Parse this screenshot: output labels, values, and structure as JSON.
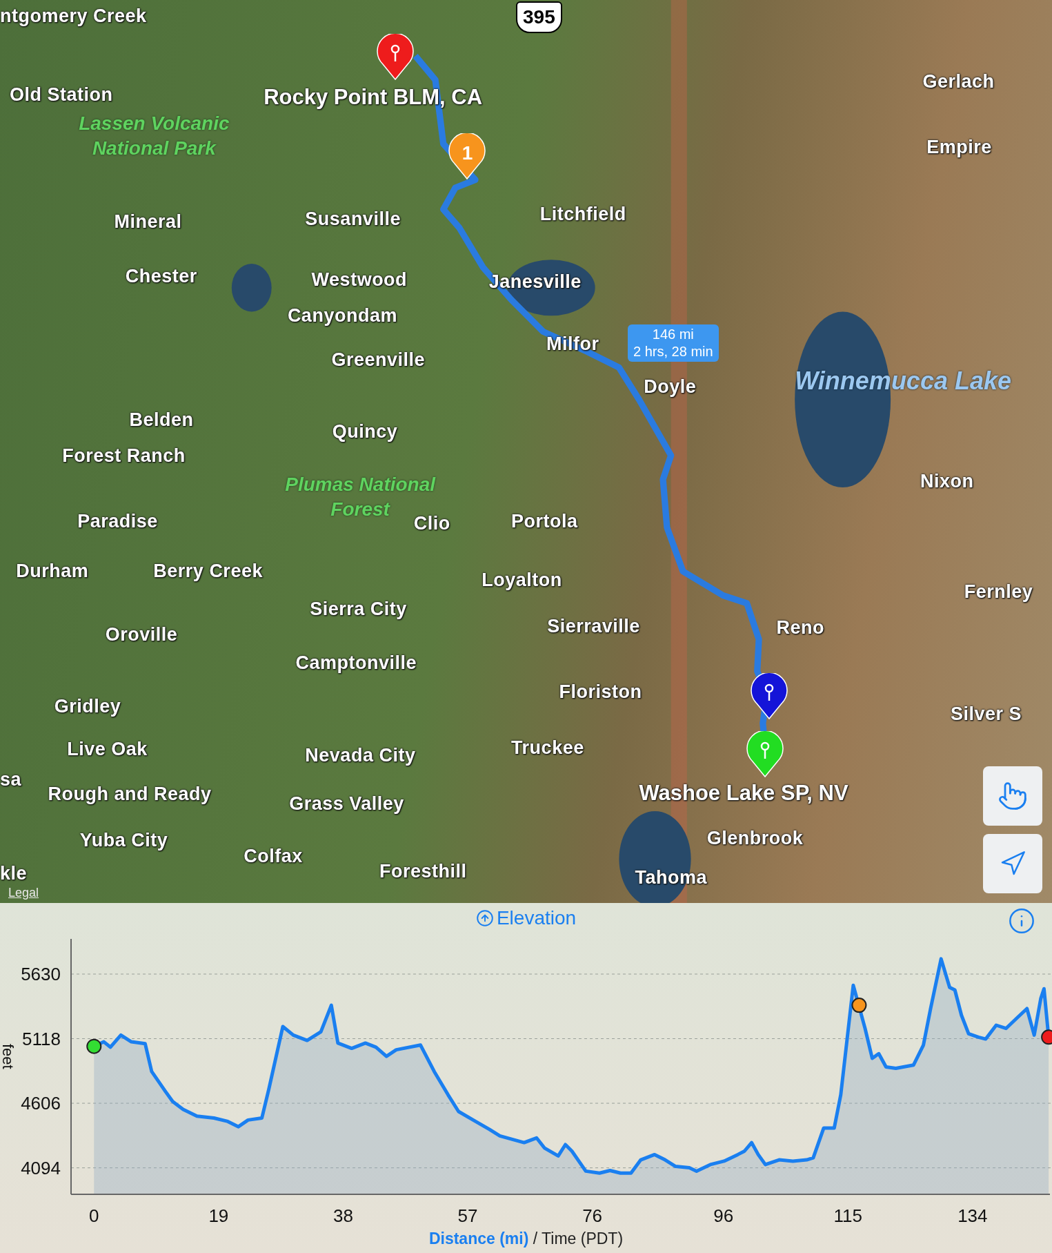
{
  "map": {
    "labels": [
      {
        "text": "ntgomery Creek",
        "kind": "place"
      },
      {
        "text": "Old Station",
        "kind": "place"
      },
      {
        "text": "Rocky Point BLM, CA",
        "kind": "poi"
      },
      {
        "text": "Gerlach",
        "kind": "place"
      },
      {
        "text": "Lassen Volcanic National Park",
        "kind": "park"
      },
      {
        "text": "Empire",
        "kind": "place"
      },
      {
        "text": "Mineral",
        "kind": "place"
      },
      {
        "text": "Susanville",
        "kind": "place"
      },
      {
        "text": "Litchfield",
        "kind": "place"
      },
      {
        "text": "Chester",
        "kind": "place"
      },
      {
        "text": "Westwood",
        "kind": "place"
      },
      {
        "text": "Janesville",
        "kind": "place"
      },
      {
        "text": "Canyondam",
        "kind": "place"
      },
      {
        "text": "Milfor",
        "kind": "place"
      },
      {
        "text": "Greenville",
        "kind": "place"
      },
      {
        "text": "Winnemucca Lake",
        "kind": "lake"
      },
      {
        "text": "Doyle",
        "kind": "place"
      },
      {
        "text": "Belden",
        "kind": "place"
      },
      {
        "text": "Quincy",
        "kind": "place"
      },
      {
        "text": "Forest Ranch",
        "kind": "place"
      },
      {
        "text": "Plumas National Forest",
        "kind": "park"
      },
      {
        "text": "Nixon",
        "kind": "place"
      },
      {
        "text": "Paradise",
        "kind": "place"
      },
      {
        "text": "Clio",
        "kind": "place"
      },
      {
        "text": "Portola",
        "kind": "place"
      },
      {
        "text": "Durham",
        "kind": "place"
      },
      {
        "text": "Berry Creek",
        "kind": "place"
      },
      {
        "text": "Loyalton",
        "kind": "place"
      },
      {
        "text": "Fernley",
        "kind": "place"
      },
      {
        "text": "Sierra City",
        "kind": "place"
      },
      {
        "text": "Sierraville",
        "kind": "place"
      },
      {
        "text": "Reno",
        "kind": "place"
      },
      {
        "text": "Oroville",
        "kind": "place"
      },
      {
        "text": "Camptonville",
        "kind": "place"
      },
      {
        "text": "Floriston",
        "kind": "place"
      },
      {
        "text": "Gridley",
        "kind": "place"
      },
      {
        "text": "Silver S",
        "kind": "place"
      },
      {
        "text": "Live Oak",
        "kind": "place"
      },
      {
        "text": "Truckee",
        "kind": "place"
      },
      {
        "text": "Nevada City",
        "kind": "place"
      },
      {
        "text": "sa",
        "kind": "place"
      },
      {
        "text": "Rough and Ready",
        "kind": "place"
      },
      {
        "text": "Washoe Lake SP, NV",
        "kind": "poi"
      },
      {
        "text": "Grass Valley",
        "kind": "place"
      },
      {
        "text": "Glenbrook",
        "kind": "place"
      },
      {
        "text": "Yuba City",
        "kind": "place"
      },
      {
        "text": "Colfax",
        "kind": "place"
      },
      {
        "text": "kle",
        "kind": "place"
      },
      {
        "text": "Foresthill",
        "kind": "place"
      },
      {
        "text": "Tahoma",
        "kind": "place"
      }
    ],
    "highway": "395",
    "pins": [
      {
        "color": "#ee1c1c"
      },
      {
        "color": "#f7941d",
        "label": "1"
      },
      {
        "color": "#1414d8"
      },
      {
        "color": "#22dd22"
      }
    ],
    "route_callout": {
      "distance": "146 mi",
      "duration": "2 hrs, 28 min"
    },
    "legal": "Legal"
  },
  "elevation": {
    "xlabel": "**Distance (mi)** / Time (PDT)",
    "markers": [
      {
        "color": "#33dd33"
      },
      {
        "color": "#f7941d"
      },
      {
        "color": "#ee1c1c"
      }
    ],
    "chart_data": {
      "type": "area",
      "title": "Elevation",
      "ylabel": "feet",
      "grid": true,
      "xlim": [
        -3.5,
        145.8
      ],
      "ylim": [
        3884,
        5909
      ],
      "xticks": [
        0,
        19,
        38,
        57,
        76,
        96,
        115,
        134
      ],
      "yticks": [
        4094,
        4606,
        5118,
        5630
      ],
      "x": [
        0,
        1.5,
        2.5,
        4.1,
        5.7,
        7.8,
        8.8,
        10.9,
        12,
        13.6,
        15.7,
        18.3,
        20.4,
        22,
        23.5,
        25.6,
        26.7,
        28.8,
        30.4,
        32.5,
        34.6,
        36.2,
        37.2,
        39.3,
        41.4,
        43,
        44.6,
        46.1,
        49.8,
        51.9,
        54,
        55.6,
        58.2,
        60.3,
        61.9,
        65.6,
        67.5,
        68.7,
        70.8,
        71.9,
        72.9,
        75,
        77.1,
        78.7,
        80.3,
        81.9,
        83.4,
        85.5,
        87.1,
        88.7,
        90.8,
        91.9,
        94,
        96.1,
        98.2,
        99.2,
        100.3,
        101.3,
        102.4,
        104.5,
        106.6,
        108.7,
        109.7,
        111.3,
        112.9,
        113.9,
        115.8,
        117.6,
        118.7,
        119.7,
        120.8,
        122.3,
        125,
        126.5,
        127.6,
        129.2,
        130.5,
        131.3,
        132.3,
        133.4,
        134.9,
        136,
        137.6,
        139.1,
        140.7,
        142.3,
        143.4,
        144.4,
        144.9,
        145.6
      ],
      "series": [
        {
          "color": "#1a7ff0",
          "values": [
            5057,
            5093,
            5051,
            5146,
            5093,
            5078,
            4857,
            4699,
            4620,
            4557,
            4504,
            4489,
            4462,
            4420,
            4473,
            4489,
            4725,
            5214,
            5146,
            5104,
            5172,
            5383,
            5083,
            5041,
            5083,
            5051,
            4978,
            5030,
            5067,
            4857,
            4673,
            4541,
            4462,
            4399,
            4347,
            4294,
            4331,
            4252,
            4189,
            4278,
            4226,
            4068,
            4052,
            4073,
            4052,
            4052,
            4157,
            4199,
            4157,
            4105,
            4094,
            4068,
            4120,
            4147,
            4199,
            4226,
            4294,
            4199,
            4120,
            4157,
            4147,
            4157,
            4173,
            4410,
            4410,
            4673,
            5541,
            5199,
            4962,
            4999,
            4894,
            4883,
            4909,
            5067,
            5356,
            5751,
            5525,
            5504,
            5304,
            5157,
            5130,
            5115,
            5225,
            5199,
            5278,
            5356,
            5146,
            5435,
            5514,
            5130
          ]
        }
      ]
    }
  }
}
